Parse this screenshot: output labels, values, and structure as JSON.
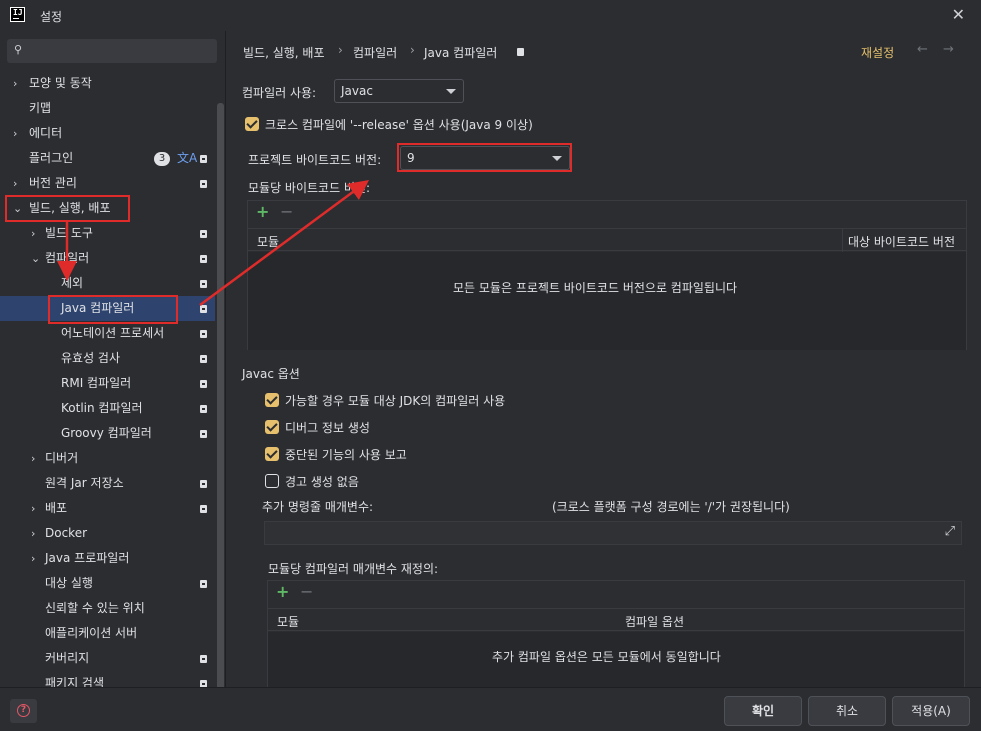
{
  "window": {
    "title": "설정"
  },
  "search": {
    "placeholder": "",
    "value": ""
  },
  "sidebar": {
    "items": [
      {
        "label": "모양 및 동작"
      },
      {
        "label": "키맵"
      },
      {
        "label": "에디터"
      },
      {
        "label": "플러그인",
        "badge": "3"
      },
      {
        "label": "버전 관리"
      },
      {
        "label": "빌드, 실행, 배포"
      },
      {
        "label": "빌드 도구"
      },
      {
        "label": "컴파일러"
      },
      {
        "label": "제외"
      },
      {
        "label": "Java 컴파일러"
      },
      {
        "label": "어노테이션 프로세서"
      },
      {
        "label": "유효성 검사"
      },
      {
        "label": "RMI 컴파일러"
      },
      {
        "label": "Kotlin 컴파일러"
      },
      {
        "label": "Groovy 컴파일러"
      },
      {
        "label": "디버거"
      },
      {
        "label": "원격 Jar 저장소"
      },
      {
        "label": "배포"
      },
      {
        "label": "Docker"
      },
      {
        "label": "Java 프로파일러"
      },
      {
        "label": "대상 실행"
      },
      {
        "label": "신뢰할 수 있는 위치"
      },
      {
        "label": "애플리케이션 서버"
      },
      {
        "label": "커버리지"
      },
      {
        "label": "패키지 검색"
      }
    ]
  },
  "breadcrumb": {
    "items": [
      "빌드, 실행, 배포",
      "컴파일러",
      "Java 컴파일러"
    ]
  },
  "header": {
    "reset_label": "재설정"
  },
  "compiler": {
    "use_label": "컴파일러 사용:",
    "use_value": "Javac",
    "release_option_label": "크로스 컴파일에 '--release' 옵션 사용(Java 9 이상)",
    "bytecode_label": "프로젝트 바이트코드 버전:",
    "bytecode_value": "9",
    "per_module_label": "모듈당 바이트코드 버전:",
    "table": {
      "col_module": "모듈",
      "col_target": "대상 바이트코드 버전",
      "empty_text": "모든 모듈은 프로젝트 바이트코드 버전으로 컴파일됩니다"
    }
  },
  "javac": {
    "section_title": "Javac 옵션",
    "options": [
      {
        "label": "가능할 경우 모듈 대상 JDK의 컴파일러 사용",
        "checked": true
      },
      {
        "label": "디버그 정보 생성",
        "checked": true
      },
      {
        "label": "중단된 기능의 사용 보고",
        "checked": true
      },
      {
        "label": "경고 생성 없음",
        "checked": false
      }
    ],
    "extra_params_label": "추가 명령줄 매개변수:",
    "extra_params_hint": "(크로스 플랫폼 구성 경로에는 '/'가 권장됩니다)",
    "extra_params_value": "",
    "override_label": "모듈당 컴파일러 매개변수 재정의:",
    "override_table": {
      "col_module": "모듈",
      "col_options": "컴파일 옵션",
      "empty_text": "추가 컴파일 옵션은 모든 모듈에서 동일합니다"
    }
  },
  "footer": {
    "ok_label": "확인",
    "cancel_label": "취소",
    "apply_label": "적용(A)"
  },
  "colors": {
    "background": "#2b2d30",
    "selection": "#2e436e",
    "accent": "#e6c06c",
    "annotation_red": "#e02b2b",
    "add_green": "#5fb865"
  }
}
